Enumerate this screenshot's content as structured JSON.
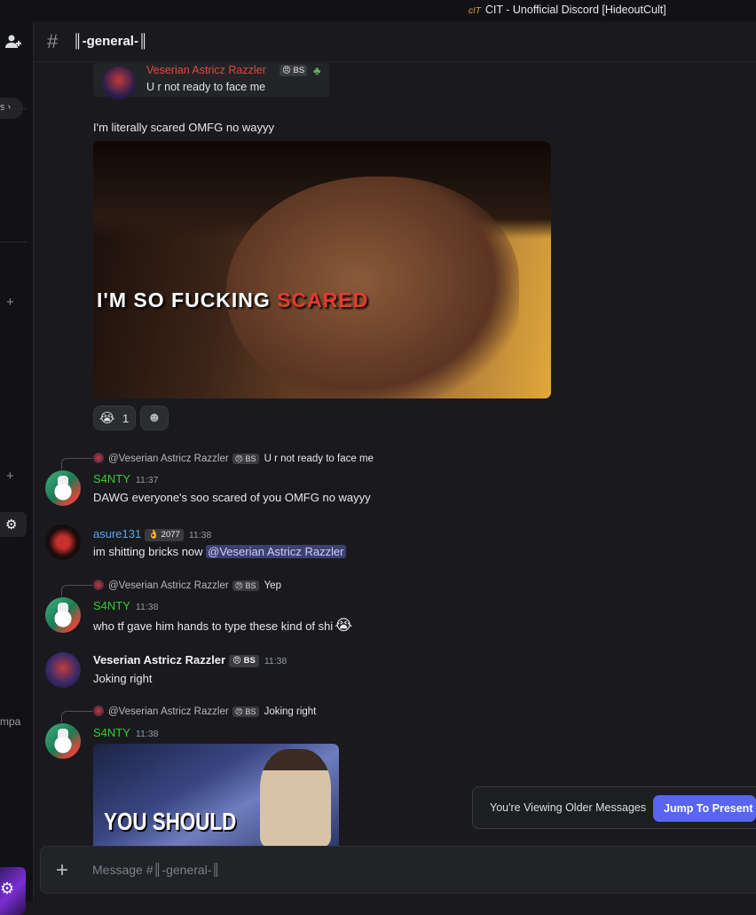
{
  "titlebar": {
    "logo_text": "cIT",
    "title": "CIT - Unofficial Discord [HideoutCult]"
  },
  "sidebar": {
    "pill_label": "s ›",
    "side_text": "mpa"
  },
  "header": {
    "hash": "#",
    "channel": "║-general-║"
  },
  "quoted_message": {
    "author": "Veserian Astricz Razzler",
    "tag": "😠 BS",
    "text": "U r not ready to face me"
  },
  "messages": {
    "m1_text": "I'm literally scared OMFG no wayyy",
    "gif_caption_white": "I'M SO FUCKING ",
    "gif_caption_red": "SCARED",
    "reaction1": {
      "emoji": "😭",
      "count": "1"
    },
    "reaction2": {
      "emoji": "☻"
    },
    "m2": {
      "reply_author": "@Veserian Astricz Razzler",
      "reply_tag": "😠 BS",
      "reply_text": "U r not ready to face me",
      "author": "S4NTY",
      "time": "11:37",
      "text": "DAWG everyone's soo scared of you OMFG no wayyy"
    },
    "m3": {
      "author": "asure131",
      "tag": "👌 2077",
      "time": "11:38",
      "text": "im shitting bricks now ",
      "mention": "@Veserian Astricz Razzler"
    },
    "m4": {
      "reply_author": "@Veserian Astricz Razzler",
      "reply_tag": "😠 BS",
      "reply_text": "Yep",
      "author": "S4NTY",
      "time": "11:38",
      "text": "who tf gave him hands to type these kind of shi",
      "emoji": "😭"
    },
    "m5": {
      "author": "Veserian Astricz Razzler",
      "tag": "😠 BS",
      "time": "11:38",
      "text": "Joking right"
    },
    "m6": {
      "reply_author": "@Veserian Astricz Razzler",
      "reply_tag": "😠 BS",
      "reply_text": "Joking right",
      "author": "S4NTY",
      "time": "11:38",
      "image_caption": "YOU SHOULD"
    }
  },
  "banner": {
    "text": "You're Viewing Older Messages",
    "button": "Jump To Present"
  },
  "composer": {
    "placeholder": "Message #║-general-║"
  },
  "colors": {
    "accent": "#5865f2",
    "santy_name": "#2dd126",
    "asure_name": "#5aa7e8",
    "razzler_name": "#e2483c"
  },
  "icons": [
    "friends-icon",
    "hash-icon",
    "add-icon",
    "settings-gear-icon",
    "frog-emoji-icon"
  ]
}
